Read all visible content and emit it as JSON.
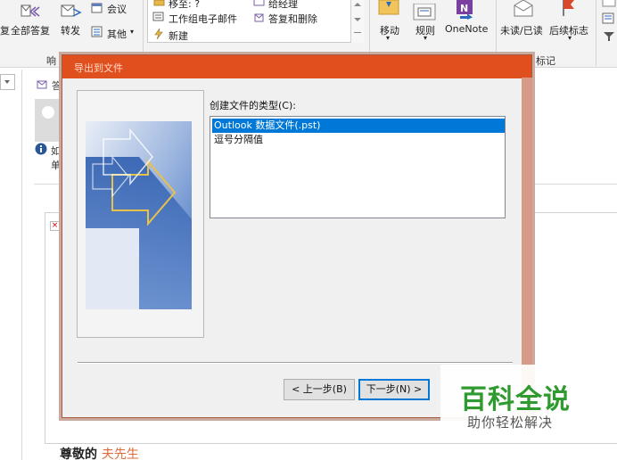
{
  "ribbon": {
    "reply_all": "全部答复",
    "forward": "转发",
    "reply_short": "复",
    "meeting": "会议",
    "other": "其他",
    "other_caret": "▾",
    "respond_group_partial": "响",
    "quick_moveto": "移至: ?",
    "quick_team_email": "工作组电子邮件",
    "quick_new": "新建",
    "quick_manager": "给经理",
    "quick_reply_delete": "答复和删除",
    "move": "移动",
    "rules": "规则",
    "onenote": "OneNote",
    "unread_read": "未读/已读",
    "followup": "后续标志",
    "tags_group": "标记",
    "caret": "▾"
  },
  "left_pane": {
    "info_partial_1": "如",
    "info_partial_2": "单",
    "header_partial": "答"
  },
  "dialog": {
    "title": "导出到文件",
    "label": "创建文件的类型(C):",
    "options": [
      "Outlook 数据文件(.pst)",
      "逗号分隔值"
    ],
    "selected_index": 0,
    "back_button": "< 上一步(B)",
    "next_button": "下一步(N) >"
  },
  "watermark": {
    "title": "百科全说",
    "subtitle": "助你轻松解决"
  },
  "mail_body": {
    "greeting": "尊敬的",
    "name": "夫先生"
  },
  "colors": {
    "accent": "#e0501e",
    "selection": "#0078d7",
    "watermark_green": "#2f9a2f"
  }
}
